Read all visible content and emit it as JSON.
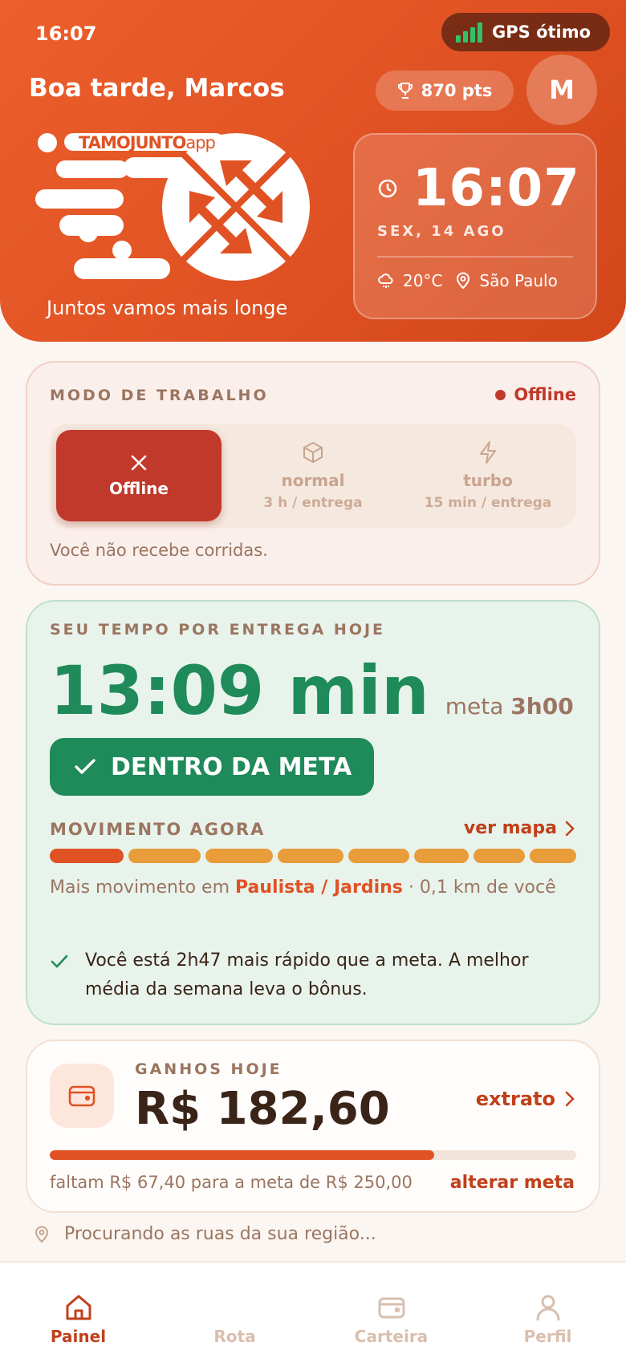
{
  "status_bar": {
    "time": "16:07",
    "gps_label": "GPS ótimo"
  },
  "header": {
    "greeting": "Boa tarde, Marcos",
    "points": "870 pts",
    "avatar_initial": "M",
    "brand_prefix": "TAMOJUNTO",
    "brand_suffix": "app",
    "slogan": "Juntos vamos mais longe",
    "clock": {
      "time": "16:07",
      "date": "SEX, 14 AGO",
      "temperature": "20°C",
      "city": "São Paulo"
    }
  },
  "work_mode": {
    "title": "MODO DE TRABALHO",
    "status": "Offline",
    "options": [
      {
        "label": "Offline",
        "subtitle": "",
        "icon": "close-icon",
        "active": true
      },
      {
        "label": "normal",
        "subtitle": "3 h / entrega",
        "icon": "box-icon",
        "active": false
      },
      {
        "label": "turbo",
        "subtitle": "15 min / entrega",
        "icon": "bolt-icon",
        "active": false
      }
    ],
    "note": "Você não recebe corridas."
  },
  "delivery_time": {
    "title": "SEU TEMPO POR ENTREGA HOJE",
    "value": "13:09 min",
    "goal_prefix": "meta",
    "goal_value": "3h00",
    "badge": "DENTRO DA META",
    "movement_title": "MOVIMENTO AGORA",
    "map_link": "ver mapa",
    "movement_prefix": "Mais movimento em",
    "movement_area": "Paulista / Jardins",
    "movement_suffix": "· 0,1 km de você",
    "tip": "Você está 2h47 mais rápido que a meta. A melhor média da semana leva o bônus."
  },
  "earnings": {
    "title": "GANHOS HOJE",
    "value": "R$ 182,60",
    "statement_link": "extrato",
    "progress": 0.73,
    "goal_text": "faltam R$ 67,40 para a meta de R$ 250,00",
    "change_goal": "alterar meta"
  },
  "searching_text": "Procurando as ruas da sua região...",
  "bottom_nav": [
    {
      "label": "Painel",
      "icon": "home-icon",
      "active": true
    },
    {
      "label": "Rota",
      "icon": "route-icon",
      "active": false
    },
    {
      "label": "Carteira",
      "icon": "wallet-icon",
      "active": false
    },
    {
      "label": "Perfil",
      "icon": "user-icon",
      "active": false
    }
  ],
  "colors": {
    "brand": "#e05223",
    "offline": "#c0392b",
    "success": "#1f8a5a",
    "movement_high": "#e05223",
    "movement_mid": "#e89c3a"
  }
}
